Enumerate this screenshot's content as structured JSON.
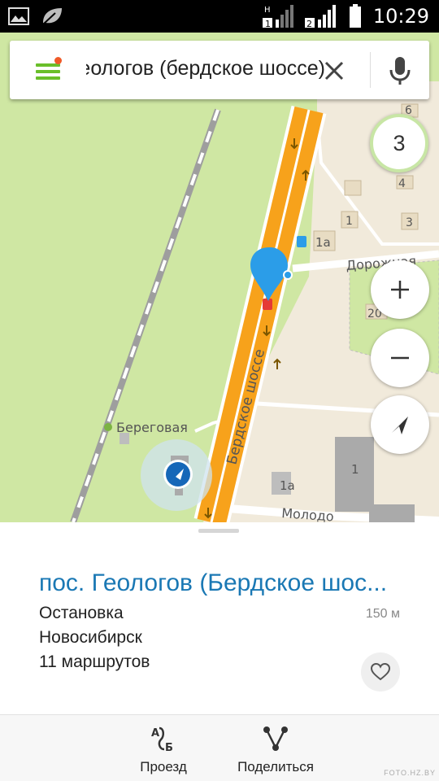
{
  "status_bar": {
    "time": "10:29",
    "sim1_label": "1",
    "sim2_label": "2",
    "network_label": "H",
    "icons": [
      "gallery-icon",
      "leaf-icon",
      "signal-sim1-icon",
      "signal-sim2-icon",
      "battery-icon"
    ]
  },
  "search": {
    "query": "пос. Геологов (бердское шоссе)",
    "menu_icon": "hamburger-menu-icon",
    "clear_icon": "close-icon",
    "mic_icon": "microphone-icon",
    "accent_color": "#6abf2a",
    "notification_color": "#f05a28"
  },
  "map": {
    "layers_count": "3",
    "labels": {
      "road_main": "Бердское шоссе",
      "road_side": "Дорожная",
      "road_bottom": "Молодо",
      "stop_nearby": "Береговая",
      "house_1a_top": "1а",
      "house_1a_bottom": "1а",
      "house_1_top": "1",
      "house_1_bottom": "1",
      "house_3": "3",
      "house_4": "4",
      "house_6": "6",
      "house_20": "20"
    },
    "zoom_in_icon": "plus-icon",
    "zoom_out_icon": "minus-icon",
    "locate_icon": "navigation-arrow-icon",
    "colors": {
      "land": "#cfe7a3",
      "road": "#f7a21b",
      "buildings": "#f1eadb",
      "pin": "#2b9de8"
    }
  },
  "place": {
    "title": "пос. Геологов (Бердское шос...",
    "type": "Остановка",
    "city": "Новосибирск",
    "routes": "11 маршрутов",
    "distance": "150 м",
    "favorite_icon": "heart-outline-icon",
    "title_color": "#1a78b4"
  },
  "actions": [
    {
      "label": "Проезд",
      "icon": "route-ab-icon"
    },
    {
      "label": "Поделиться",
      "icon": "share-icon"
    }
  ],
  "watermark": "FOTO.HZ.BY"
}
